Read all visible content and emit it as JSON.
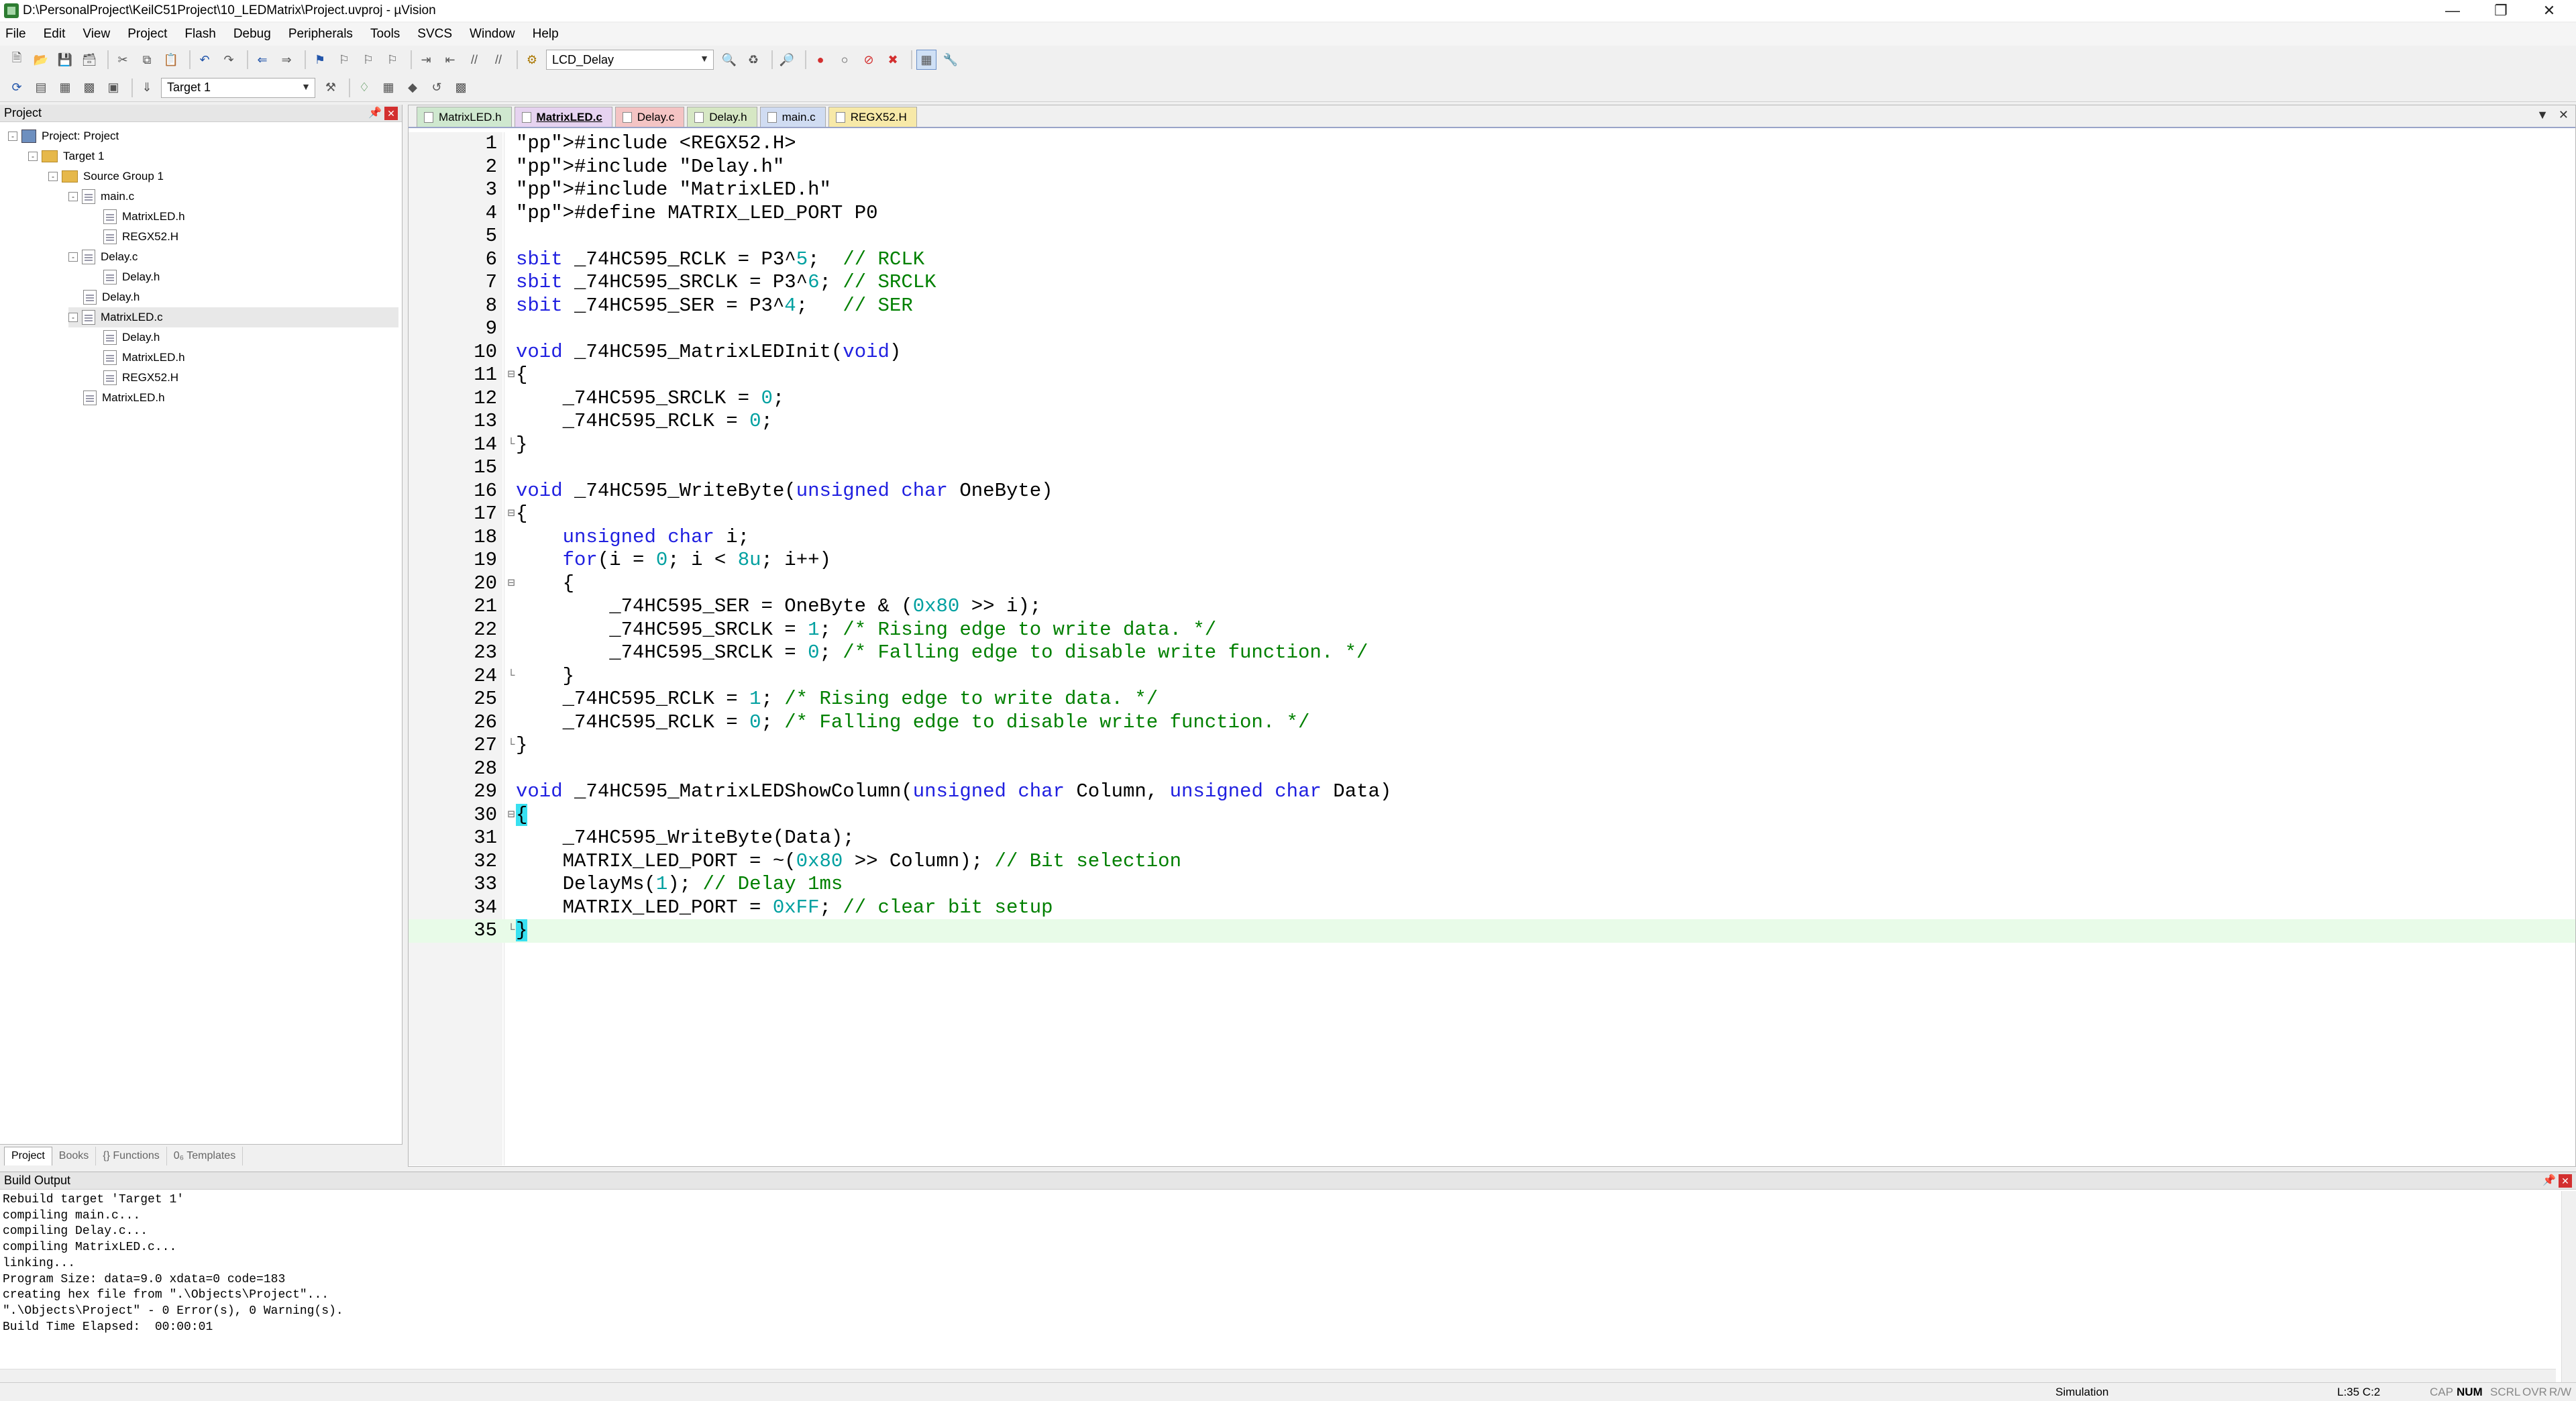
{
  "window": {
    "title": "D:\\PersonalProject\\KeilC51Project\\10_LEDMatrix\\Project.uvproj - µVision",
    "controls": [
      "minimize",
      "restore",
      "close"
    ]
  },
  "menu": [
    "File",
    "Edit",
    "View",
    "Project",
    "Flash",
    "Debug",
    "Peripherals",
    "Tools",
    "SVCS",
    "Window",
    "Help"
  ],
  "toolbar": {
    "find_combo": "LCD_Delay",
    "target_combo": "Target 1"
  },
  "project_pane": {
    "title": "Project",
    "tree": [
      {
        "label": "Project: Project",
        "icon": "project-icon",
        "expander": "-"
      },
      {
        "label": "Target 1",
        "icon": "folder-icon",
        "expander": "-"
      },
      {
        "label": "Source Group 1",
        "icon": "folder-icon",
        "expander": "-"
      },
      {
        "label": "main.c",
        "icon": "file-icon",
        "expander": "-"
      },
      {
        "label": "MatrixLED.h",
        "icon": "file-icon",
        "expander": ""
      },
      {
        "label": "REGX52.H",
        "icon": "file-icon",
        "expander": ""
      },
      {
        "label": "Delay.c",
        "icon": "file-icon",
        "expander": "-"
      },
      {
        "label": "Delay.h",
        "icon": "file-icon",
        "expander": ""
      },
      {
        "label": "Delay.h",
        "icon": "file-icon",
        "expander": ""
      },
      {
        "label": "MatrixLED.c",
        "icon": "file-icon",
        "expander": "-"
      },
      {
        "label": "Delay.h",
        "icon": "file-icon",
        "expander": ""
      },
      {
        "label": "MatrixLED.h",
        "icon": "file-icon",
        "expander": ""
      },
      {
        "label": "REGX52.H",
        "icon": "file-icon",
        "expander": ""
      },
      {
        "label": "MatrixLED.h",
        "icon": "file-icon",
        "expander": ""
      }
    ],
    "bottom_tabs": [
      "Project",
      "Books",
      "{} Functions",
      "0₆ Templates"
    ]
  },
  "editor": {
    "tabs": [
      {
        "label": "MatrixLED.h",
        "color": "#cfe8cf",
        "active": false
      },
      {
        "label": "MatrixLED.c",
        "color": "#e6d3f0",
        "active": true
      },
      {
        "label": "Delay.c",
        "color": "#f4c4c4",
        "active": false
      },
      {
        "label": "Delay.h",
        "color": "#d6e7c4",
        "active": false
      },
      {
        "label": "main.c",
        "color": "#d0dcf2",
        "active": false
      },
      {
        "label": "REGX52.H",
        "color": "#f7e9a8",
        "active": false
      }
    ],
    "current_line": 35,
    "lines": [
      {
        "n": "1",
        "text": "#include <REGX52.H>"
      },
      {
        "n": "2",
        "text": "#include \"Delay.h\""
      },
      {
        "n": "3",
        "text": "#include \"MatrixLED.h\""
      },
      {
        "n": "4",
        "text": "#define MATRIX_LED_PORT P0"
      },
      {
        "n": "5",
        "text": ""
      },
      {
        "n": "6",
        "text": "sbit _74HC595_RCLK = P3^5;  // RCLK"
      },
      {
        "n": "7",
        "text": "sbit _74HC595_SRCLK = P3^6; // SRCLK"
      },
      {
        "n": "8",
        "text": "sbit _74HC595_SER = P3^4;   // SER"
      },
      {
        "n": "9",
        "text": ""
      },
      {
        "n": "10",
        "text": "void _74HC595_MatrixLEDInit(void)"
      },
      {
        "n": "11",
        "text": "{"
      },
      {
        "n": "12",
        "text": "    _74HC595_SRCLK = 0;"
      },
      {
        "n": "13",
        "text": "    _74HC595_RCLK = 0;"
      },
      {
        "n": "14",
        "text": "}"
      },
      {
        "n": "15",
        "text": ""
      },
      {
        "n": "16",
        "text": "void _74HC595_WriteByte(unsigned char OneByte)"
      },
      {
        "n": "17",
        "text": "{"
      },
      {
        "n": "18",
        "text": "    unsigned char i;"
      },
      {
        "n": "19",
        "text": "    for(i = 0; i < 8u; i++)"
      },
      {
        "n": "20",
        "text": "    {"
      },
      {
        "n": "21",
        "text": "        _74HC595_SER = OneByte & (0x80 >> i);"
      },
      {
        "n": "22",
        "text": "        _74HC595_SRCLK = 1; /* Rising edge to write data. */"
      },
      {
        "n": "23",
        "text": "        _74HC595_SRCLK = 0; /* Falling edge to disable write function. */"
      },
      {
        "n": "24",
        "text": "    }"
      },
      {
        "n": "25",
        "text": "    _74HC595_RCLK = 1; /* Rising edge to write data. */"
      },
      {
        "n": "26",
        "text": "    _74HC595_RCLK = 0; /* Falling edge to disable write function. */"
      },
      {
        "n": "27",
        "text": "}"
      },
      {
        "n": "28",
        "text": ""
      },
      {
        "n": "29",
        "text": "void _74HC595_MatrixLEDShowColumn(unsigned char Column, unsigned char Data)"
      },
      {
        "n": "30",
        "text": "{"
      },
      {
        "n": "31",
        "text": "    _74HC595_WriteByte(Data);"
      },
      {
        "n": "32",
        "text": "    MATRIX_LED_PORT = ~(0x80 >> Column); // Bit selection"
      },
      {
        "n": "33",
        "text": "    DelayMs(1); // Delay 1ms"
      },
      {
        "n": "34",
        "text": "    MATRIX_LED_PORT = 0xFF; // clear bit setup"
      },
      {
        "n": "35",
        "text": "}"
      }
    ]
  },
  "build_output": {
    "title": "Build Output",
    "lines": [
      "Rebuild target 'Target 1'",
      "compiling main.c...",
      "compiling Delay.c...",
      "compiling MatrixLED.c...",
      "linking...",
      "Program Size: data=9.0 xdata=0 code=183",
      "creating hex file from \".\\Objects\\Project\"...",
      "\".\\Objects\\Project\" - 0 Error(s), 0 Warning(s).",
      "Build Time Elapsed:  00:00:01"
    ]
  },
  "status": {
    "mode": "Simulation",
    "position": "L:35 C:2",
    "indicators": [
      "CAP",
      "NUM",
      "SCRL",
      "OVR",
      "R/W"
    ]
  }
}
